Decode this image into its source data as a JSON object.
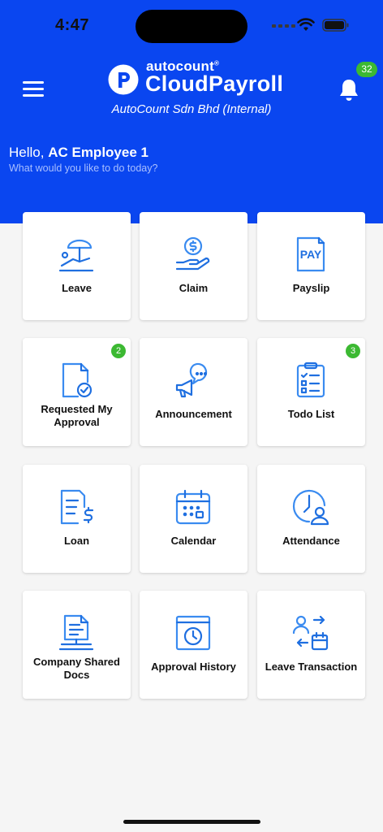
{
  "status": {
    "time": "4:47"
  },
  "header": {
    "brand_small": "autocount",
    "brand_registered": "®",
    "brand_big": "CloudPayroll",
    "company": "AutoCount Sdn Bhd (Internal)",
    "notification_count": "32"
  },
  "greeting": {
    "hello": "Hello,",
    "name": "AC Employee 1",
    "subtitle": "What would you like to do today?"
  },
  "tiles": [
    {
      "label": "Leave",
      "icon": "leave-icon"
    },
    {
      "label": "Claim",
      "icon": "claim-icon"
    },
    {
      "label": "Payslip",
      "icon": "payslip-icon",
      "icon_text": "PAY"
    },
    {
      "label": "Requested My Approval",
      "icon": "approval-request-icon",
      "badge": "2"
    },
    {
      "label": "Announcement",
      "icon": "megaphone-icon"
    },
    {
      "label": "Todo List",
      "icon": "checklist-icon",
      "badge": "3"
    },
    {
      "label": "Loan",
      "icon": "loan-icon"
    },
    {
      "label": "Calendar",
      "icon": "calendar-icon"
    },
    {
      "label": "Attendance",
      "icon": "attendance-icon"
    },
    {
      "label": "Company Shared Docs",
      "icon": "shared-docs-icon"
    },
    {
      "label": "Approval History",
      "icon": "approval-history-icon"
    },
    {
      "label": "Leave Transaction",
      "icon": "leave-transaction-icon"
    }
  ],
  "colors": {
    "header": "#0a46f0",
    "icon_accent": "#1f6fe0",
    "badge": "#3cb932"
  }
}
